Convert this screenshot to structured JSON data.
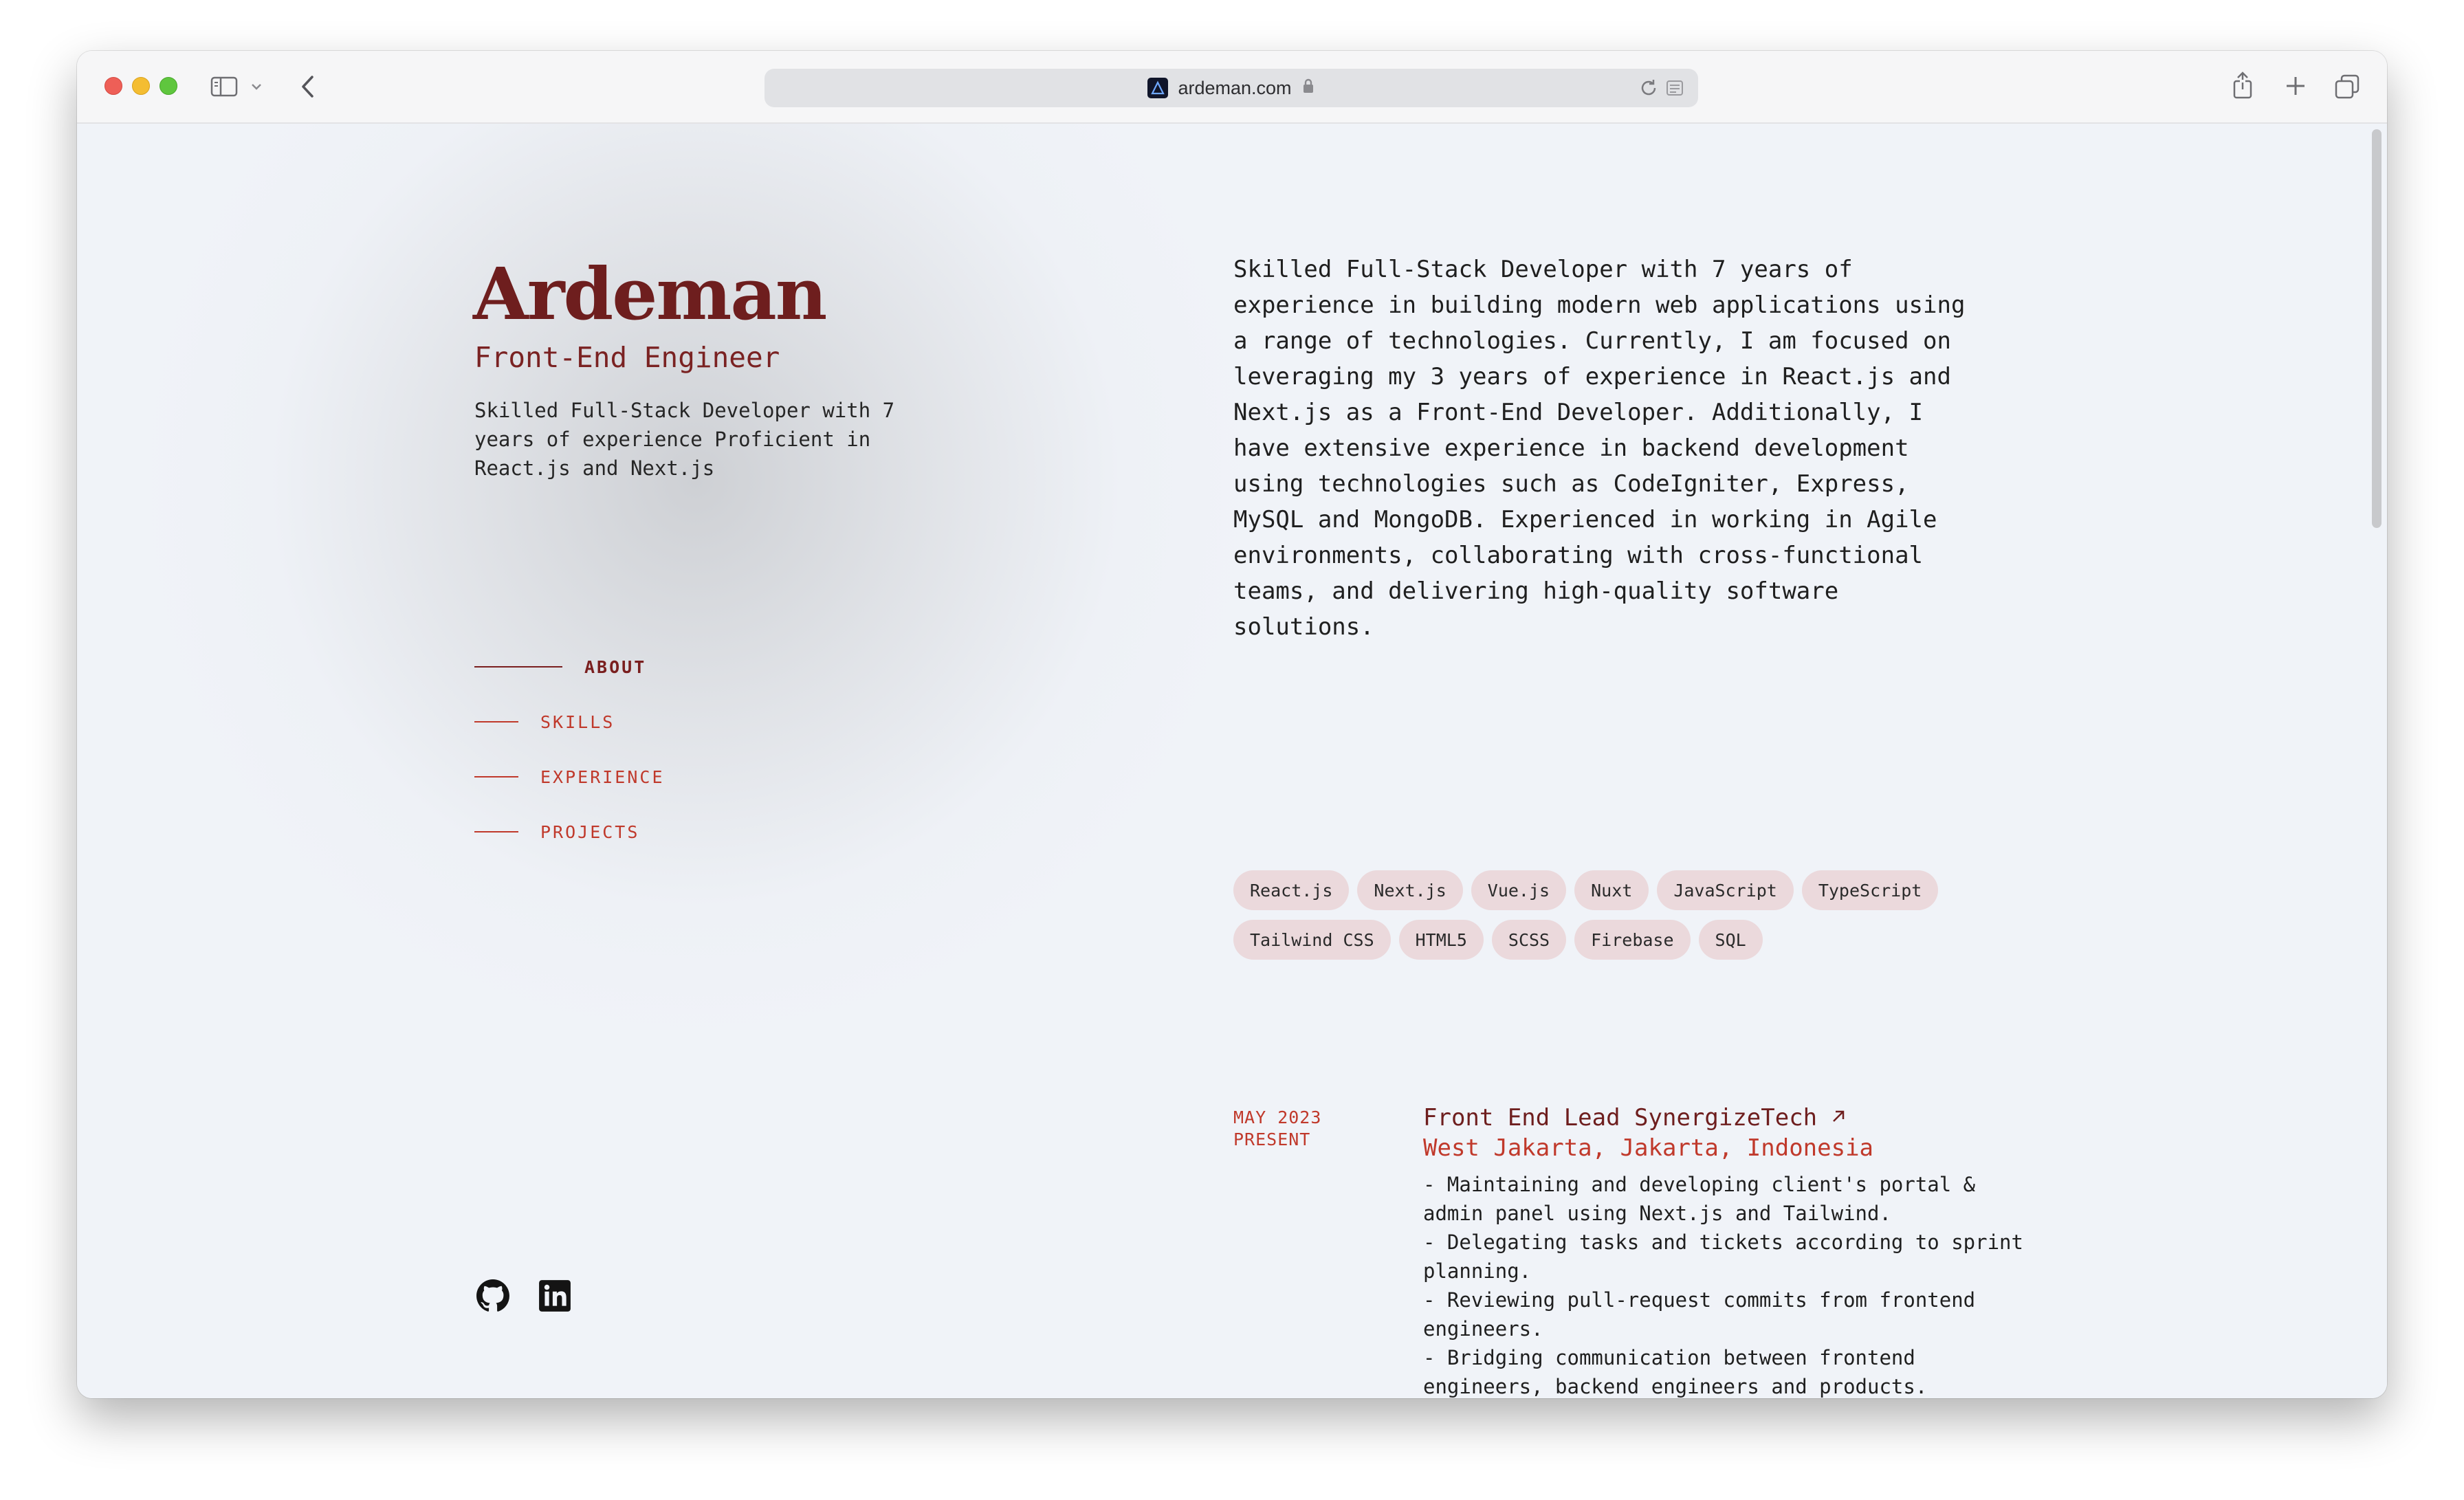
{
  "browser": {
    "url": "ardeman.com"
  },
  "profile": {
    "name": "Ardeman",
    "role": "Front-End Engineer",
    "tagline": "Skilled Full-Stack Developer with 7 years of experience Proficient in React.js and Next.js"
  },
  "nav": [
    {
      "label": "ABOUT",
      "active": true
    },
    {
      "label": "SKILLS",
      "active": false
    },
    {
      "label": "EXPERIENCE",
      "active": false
    },
    {
      "label": "PROJECTS",
      "active": false
    }
  ],
  "about": "Skilled Full-Stack Developer with 7 years of experience in building modern web applications using a range of technologies. Currently, I am focused on leveraging my 3 years of experience in React.js and Next.js as a Front-End Developer. Additionally, I have extensive experience in backend development using technologies such as CodeIgniter, Express, MySQL and MongoDB. Experienced in working in Agile environments, collaborating with cross-functional teams, and delivering high-quality software solutions.",
  "skills": [
    "React.js",
    "Next.js",
    "Vue.js",
    "Nuxt",
    "JavaScript",
    "TypeScript",
    "Tailwind CSS",
    "HTML5",
    "SCSS",
    "Firebase",
    "SQL"
  ],
  "experience": [
    {
      "date_start": "MAY 2023",
      "date_end": "PRESENT",
      "title": "Front End Lead SynergizeTech",
      "location": "West Jakarta, Jakarta, Indonesia",
      "bullets": [
        "- Maintaining and developing client's portal & admin panel using Next.js and Tailwind.",
        "- Delegating tasks and tickets according to sprint planning.",
        "- Reviewing pull-request commits from frontend engineers.",
        "- Bridging communication between frontend engineers, backend engineers and products."
      ]
    }
  ],
  "socials": [
    {
      "icon": "github-icon"
    },
    {
      "icon": "linkedin-icon"
    }
  ],
  "colors": {
    "accent_dark": "#6e1e1e",
    "accent": "#c0392b",
    "chip_bg": "#ebd9dc",
    "page_bg": "#f0f3f8"
  }
}
